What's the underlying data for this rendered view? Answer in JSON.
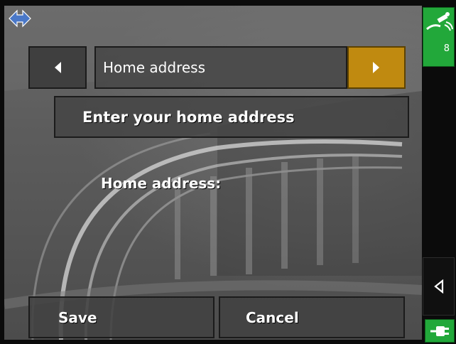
{
  "navigation": {
    "prev_icon": "caret-left-icon",
    "next_icon": "caret-right-icon",
    "title": "Home address",
    "next_color": "#c08a10"
  },
  "header": {
    "banner_text": "Enter your home address"
  },
  "form": {
    "field_label": "Home address:",
    "field_value": ""
  },
  "buttons": {
    "save_label": "Save",
    "cancel_label": "Cancel"
  },
  "status": {
    "gps_icon": "satellite-icon",
    "satellite_count": "8",
    "gps_color": "#22a83a",
    "back_icon": "triangle-left-icon",
    "power_icon": "power-plug-icon"
  },
  "logo": {
    "icon": "direction-arrows-icon",
    "color": "#4a78c8"
  }
}
